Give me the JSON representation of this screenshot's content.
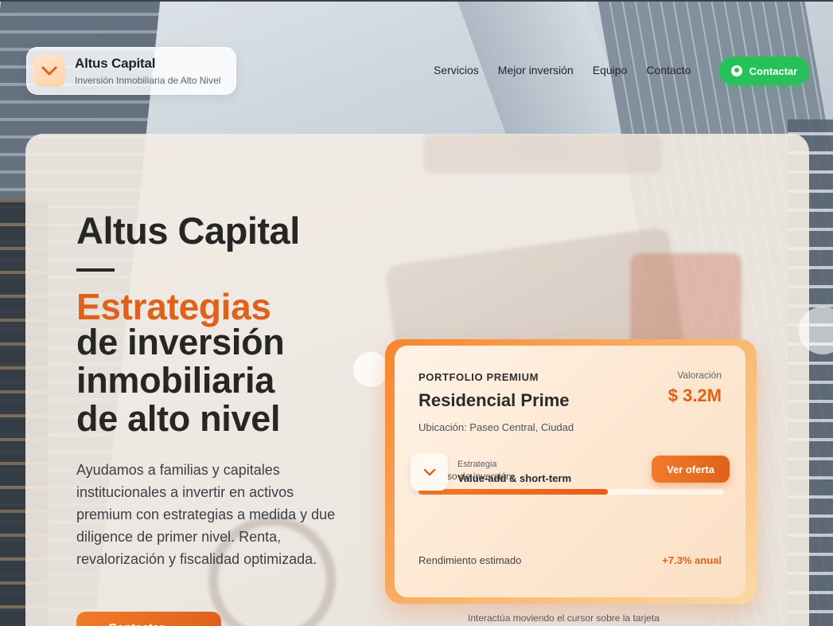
{
  "header": {
    "brand_title": "Altus Capital",
    "brand_subtitle": "Inversión Inmobiliaria de Alto Nivel",
    "nav": [
      "Servicios",
      "Mejor inversión",
      "Equipo",
      "Contacto"
    ],
    "contact_label": "Contactar"
  },
  "hero": {
    "title": "Altus Capital",
    "accent": "Estrategias",
    "line1": "de inversión",
    "line2": "inmobiliaria",
    "line3": "de alto nivel",
    "description": "Ayudamos a familias y capitales institucionales a invertir en activos premium con estrategias a medida y due diligence de primer nivel. Renta, revalorización y fiscalidad optimizada.",
    "cta_label": "Contactar",
    "hint": "Interactúa moviendo el cursor sobre la tarjeta"
  },
  "card": {
    "label": "PORTFOLIO PREMIUM",
    "title": "Residencial Prime",
    "location": "Ubicación: Paseo Central, Ciudad",
    "valuation_label": "Valoración",
    "valuation": "$ 3.2M",
    "progress_label": "Progreso de inversión",
    "progress": 0.62,
    "strategy_label": "Estrategia",
    "strategy_value": "Value-add & short-term",
    "offer_button": "Ver oferta",
    "yield_label": "Rendimiento estimado",
    "yield_value": "+7.3% anual"
  },
  "colors": {
    "accent": "#e0621a",
    "whatsapp": "#25c25a"
  }
}
